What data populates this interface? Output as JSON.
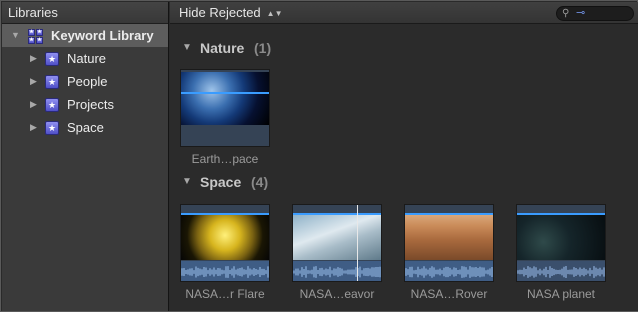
{
  "libraries": {
    "header": "Libraries",
    "root": {
      "label": "Keyword Library",
      "disclosure": "▼"
    },
    "items": [
      {
        "label": "Nature",
        "disclosure": "▶"
      },
      {
        "label": "People",
        "disclosure": "▶"
      },
      {
        "label": "Projects",
        "disclosure": "▶"
      },
      {
        "label": "Space",
        "disclosure": "▶"
      }
    ]
  },
  "toolbar": {
    "filter_label": "Hide Rejected",
    "filter_arrows": "▲▼"
  },
  "groups": [
    {
      "name": "Nature",
      "count": "(1)",
      "clips": [
        {
          "name": "Earth…pace",
          "icon": "earth-thumbnail"
        }
      ]
    },
    {
      "name": "Space",
      "count": "(4)",
      "clips": [
        {
          "name": "NASA…r Flare",
          "icon": "solar-flare-thumbnail"
        },
        {
          "name": "NASA…eavor",
          "icon": "endeavor-thumbnail"
        },
        {
          "name": "NASA…Rover",
          "icon": "mars-rover-thumbnail"
        },
        {
          "name": "NASA planet",
          "icon": "planet-thumbnail"
        }
      ]
    }
  ],
  "colors": {
    "accent_blue": "#3a9cff",
    "keyword_icon": "#6e6ee0",
    "selection": "#5d5d5d"
  }
}
